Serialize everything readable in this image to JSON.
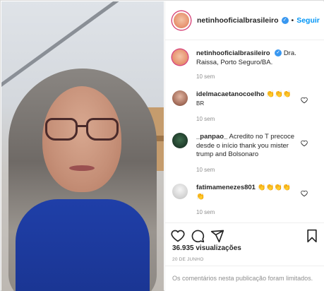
{
  "post": {
    "username": "netinhooficialbrasileiro",
    "follow_label": "Seguir",
    "caption": {
      "username": "netinhooficialbrasileiro",
      "text": "Dra. Raissa, Porto Seguro/BA.",
      "time": "10 sem"
    }
  },
  "comments": [
    {
      "username": "idelmacaetanocoelho",
      "text": "👏👏👏",
      "subtext": "BR",
      "time": "10 sem",
      "avatar_color": "#a9725f"
    },
    {
      "username": "_panpao_",
      "text": "Acredito no T precoce desde o início thank you mister trump and Bolsonaro",
      "time": "10 sem",
      "avatar_color": "#1f3a2a"
    },
    {
      "username": "fatimamenezes801",
      "text": "👏👏👏👏👏",
      "time": "10 sem",
      "avatar_color": "#cfcfcf"
    }
  ],
  "stats": {
    "views": "36.935 visualizações",
    "date": "20 DE JUNHO"
  },
  "footer": {
    "limited_text": "Os comentários nesta publicação foram limitados."
  },
  "colors": {
    "link": "#0095f6",
    "muted": "#8e8e8e",
    "text": "#262626"
  },
  "icons": [
    "more-icon",
    "heart-icon",
    "comment-icon",
    "share-icon",
    "bookmark-icon",
    "verified-icon"
  ]
}
